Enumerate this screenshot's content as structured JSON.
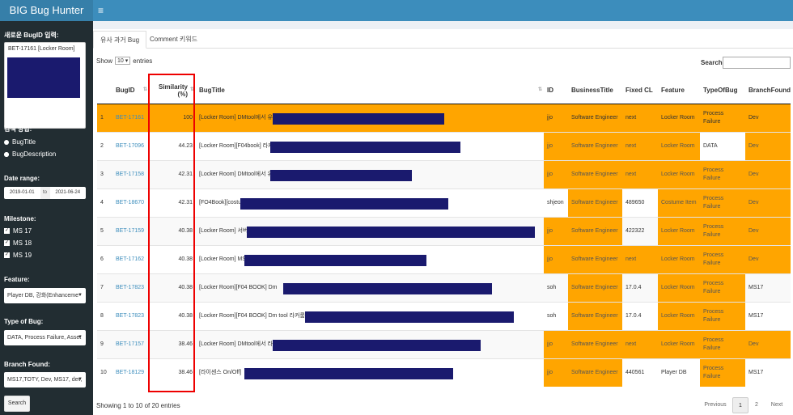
{
  "app": {
    "title": "BIG Bug Hunter",
    "menu_icon": "≡"
  },
  "sidebar": {
    "bugid_label": "새로운 BugID 입력:",
    "bugid_value": "BET-17161 [Locker Room]",
    "search_method_label": "검색 방법:",
    "search_methods": [
      "BugTitle",
      "BugDescription"
    ],
    "date_range_label": "Date range:",
    "date_from": "2019-01-01",
    "date_to_sep": "to",
    "date_to": "2021-06-24",
    "milestone_label": "Milestone:",
    "milestones": [
      "MS 17",
      "MS 18",
      "MS 19"
    ],
    "feature_label": "Feature:",
    "feature_value": "Player DB, 강화(Enhanceme",
    "type_label": "Type of Bug:",
    "type_value": "DATA, Process Failure, Asset",
    "branch_label": "Branch Found:",
    "branch_value": "MS17,TOTY, Dev, MS17, dev,",
    "search_button": "Search"
  },
  "tabs": [
    "유사 과거 Bug",
    "Comment 키워드"
  ],
  "table_controls": {
    "show": "Show",
    "entries_value": "10",
    "entries": "entries",
    "search_label": "Search:"
  },
  "columns": [
    "",
    "BugID",
    "Similarity (%)",
    "BugTitle",
    "ID",
    "BusinessTitle",
    "Fixed CL",
    "Feature",
    "TypeOfBug",
    "BranchFound"
  ],
  "rows": [
    {
      "n": "1",
      "bugid": "BET-17161",
      "sim": "100",
      "title": "[Locker Room] DMtool에서 유내",
      "id": "jjo",
      "biz": "Software Engineer",
      "cl": "next",
      "feature": "Locker Room",
      "type": "Process Failure",
      "branch": "Dev"
    },
    {
      "n": "2",
      "bugid": "BET-17096",
      "sim": "44.23",
      "title": "[Locker Room][F04book] 라커편",
      "id": "jjo",
      "biz": "Software Engineer",
      "cl": "next",
      "feature": "Locker Room",
      "type": "DATA",
      "branch": "Dev"
    },
    {
      "n": "3",
      "bugid": "BET-17158",
      "sim": "42.31",
      "title": "[Locker Room] DMtool에서 유내",
      "id": "jjo",
      "biz": "Software Engineer",
      "cl": "next",
      "feature": "Locker Room",
      "type": "Process Failure",
      "branch": "Dev"
    },
    {
      "n": "4",
      "bugid": "BET-18670",
      "sim": "42.31",
      "title": "[FO4Book][costum",
      "id": "shjeon",
      "biz": "Software Engineer",
      "cl": "489650",
      "feature": "Costume Item",
      "type": "Process Failure",
      "branch": "Dev"
    },
    {
      "n": "5",
      "bugid": "BET-17159",
      "sim": "40.38",
      "title": "[Locker Room] 서버",
      "id": "jjo",
      "biz": "Software Engineer",
      "cl": "422322",
      "feature": "Locker Room",
      "type": "Process Failure",
      "branch": "Dev"
    },
    {
      "n": "6",
      "bugid": "BET-17162",
      "sim": "40.38",
      "title": "[Locker Room] MS1",
      "id": "jjo",
      "biz": "Software Engineer",
      "cl": "next",
      "feature": "Locker Room",
      "type": "Process Failure",
      "branch": "Dev"
    },
    {
      "n": "7",
      "bugid": "BET-17823",
      "sim": "40.38",
      "title": "[Locker Room][F04 BOOK] Dm",
      "id": "soh",
      "biz": "Software Engineer",
      "cl": "17.0.4",
      "feature": "Locker Room",
      "type": "Process Failure",
      "branch": "MS17"
    },
    {
      "n": "8",
      "bugid": "BET-17823",
      "sim": "40.38",
      "title": "[Locker Room][F04 BOOK] Dm tool 라커룸 유",
      "id": "soh",
      "biz": "Software Engineer",
      "cl": "17.0.4",
      "feature": "Locker Room",
      "type": "Process Failure",
      "branch": "MS17"
    },
    {
      "n": "9",
      "bugid": "BET-17157",
      "sim": "38.46",
      "title": "[Locker Room] DMtool에서 라",
      "id": "jjo",
      "biz": "Software Engineer",
      "cl": "next",
      "feature": "Locker Room",
      "type": "Process Failure",
      "branch": "Dev"
    },
    {
      "n": "10",
      "bugid": "BET-18129",
      "sim": "38.46",
      "title": "[라이센스 On/Off] ",
      "id": "jjo",
      "biz": "Software Engineer",
      "cl": "440561",
      "feature": "Player DB",
      "type": "Process Failure",
      "branch": "MS17"
    }
  ],
  "footer": {
    "info": "Showing 1 to 10 of 20 entries",
    "previous": "Previous",
    "page1": "1",
    "page2": "2",
    "next": "Next"
  }
}
